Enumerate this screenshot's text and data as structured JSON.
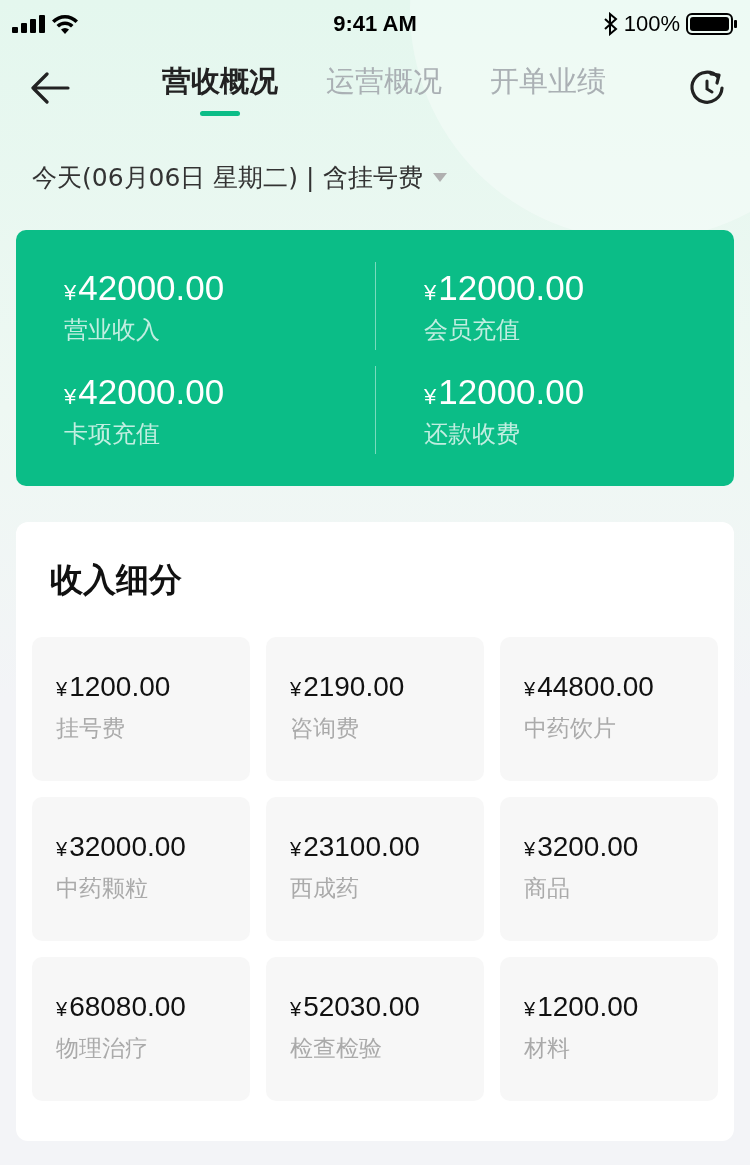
{
  "status_bar": {
    "time": "9:41 AM",
    "battery": "100%"
  },
  "tabs": [
    {
      "label": "营收概况",
      "selected": true
    },
    {
      "label": "运营概况",
      "selected": false
    },
    {
      "label": "开单业绩",
      "selected": false
    }
  ],
  "date_bar": {
    "date": "今天(06月06日 星期二)",
    "separator": "|",
    "filter": "含挂号费"
  },
  "summary": [
    {
      "currency": "¥",
      "amount": "42000.00",
      "label": "营业收入"
    },
    {
      "currency": "¥",
      "amount": "12000.00",
      "label": "会员充值"
    },
    {
      "currency": "¥",
      "amount": "42000.00",
      "label": "卡项充值"
    },
    {
      "currency": "¥",
      "amount": "12000.00",
      "label": "还款收费"
    }
  ],
  "breakdown": {
    "title": "收入细分",
    "items": [
      {
        "currency": "¥",
        "amount": "1200.00",
        "label": "挂号费"
      },
      {
        "currency": "¥",
        "amount": "2190.00",
        "label": "咨询费"
      },
      {
        "currency": "¥",
        "amount": "44800.00",
        "label": "中药饮片"
      },
      {
        "currency": "¥",
        "amount": "32000.00",
        "label": "中药颗粒"
      },
      {
        "currency": "¥",
        "amount": "23100.00",
        "label": "西成药"
      },
      {
        "currency": "¥",
        "amount": "3200.00",
        "label": "商品"
      },
      {
        "currency": "¥",
        "amount": "68080.00",
        "label": "物理治疗"
      },
      {
        "currency": "¥",
        "amount": "52030.00",
        "label": "检查检验"
      },
      {
        "currency": "¥",
        "amount": "1200.00",
        "label": "材料"
      }
    ]
  }
}
